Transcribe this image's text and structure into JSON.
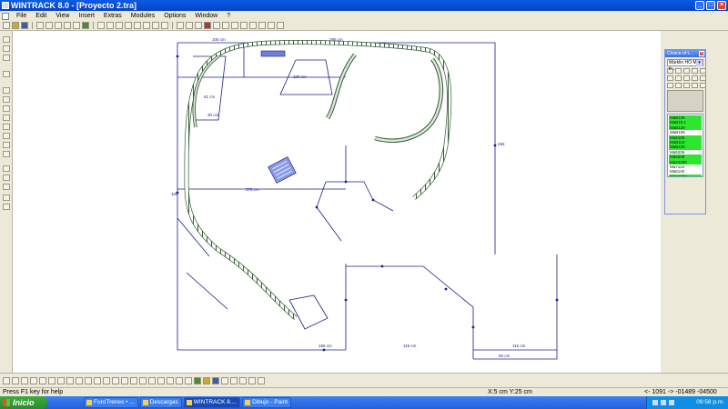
{
  "window": {
    "title": "WINTRACK 8.0 - [Proyecto 2.tra]"
  },
  "menu": [
    "File",
    "Edit",
    "View",
    "Insert",
    "Extras",
    "Modules",
    "Options",
    "Window",
    "?"
  ],
  "panel": {
    "title": "Choice of t...",
    "select_value": "Märklin HO M-tr..."
  },
  "articles": [
    {
      "label": "MaB106",
      "green": true
    },
    {
      "label": "MaB10.1",
      "green": true
    },
    {
      "label": "MaB126",
      "green": true
    },
    {
      "label": "MaB106",
      "green": false
    },
    {
      "label": "Ma5106",
      "green": true
    },
    {
      "label": "MaB110",
      "green": true
    },
    {
      "label": "MaB106",
      "green": true
    },
    {
      "label": "Ma5206",
      "green": false
    },
    {
      "label": "Ma5208",
      "green": true
    },
    {
      "label": "Ma24250",
      "green": true
    },
    {
      "label": "Ma7131",
      "green": false
    },
    {
      "label": "Ma5140",
      "green": false
    },
    {
      "label": "Ma24280",
      "green": true
    }
  ],
  "status": {
    "help": "Press F1 key for help",
    "coords": "X:5 cm Y:25 cm",
    "values": "<- 1091 ->    -01489   -04500"
  },
  "taskbar": {
    "start": "Inicio",
    "tasks": [
      "ForoTrenes • ...",
      "Descargas",
      "WINTRACK 8....",
      "Dibujo - Paint"
    ],
    "clock": "09:58 p.m."
  },
  "drawing_labels": {
    "top_1": "105 cm",
    "top_2": "295 cm",
    "top_3": "30 cm",
    "right_1": "265",
    "mid_1": "100 cm",
    "mid_2": "375 cm",
    "mid_3": "61 cm",
    "bot_1": "165 cm",
    "bot_2": "115 cm",
    "bot_3": "55 cm",
    "bot_4": "115 cm",
    "left_1": "105"
  }
}
